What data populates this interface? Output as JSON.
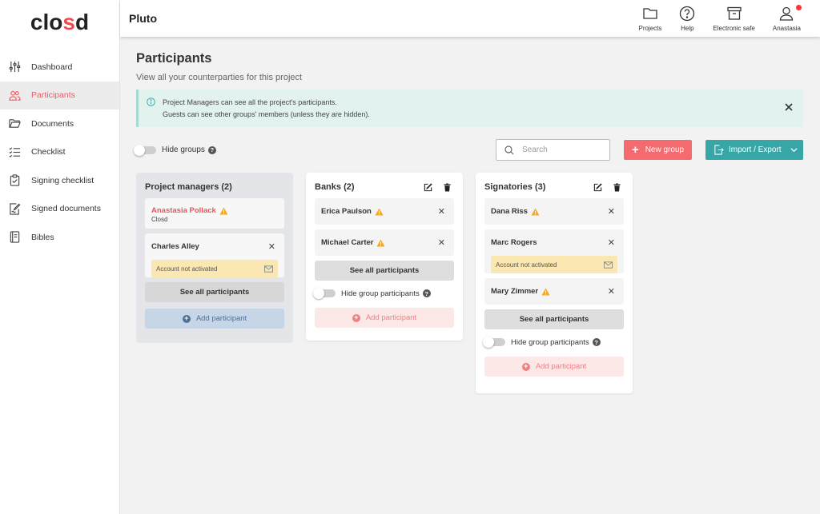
{
  "app": {
    "logo_prefix": "clo",
    "logo_mid": "s",
    "logo_suffix": "d",
    "project_name": "Pluto"
  },
  "sidebar": {
    "items": [
      {
        "label": "Dashboard",
        "icon": "sliders-icon"
      },
      {
        "label": "Participants",
        "icon": "users-icon",
        "active": true
      },
      {
        "label": "Documents",
        "icon": "folder-open-icon"
      },
      {
        "label": "Checklist",
        "icon": "checklist-icon"
      },
      {
        "label": "Signing checklist",
        "icon": "clipboard-icon"
      },
      {
        "label": "Signed documents",
        "icon": "signed-document-icon"
      },
      {
        "label": "Bibles",
        "icon": "book-icon"
      }
    ]
  },
  "topbar": {
    "actions": [
      {
        "label": "Projects",
        "icon": "folder-icon"
      },
      {
        "label": "Help",
        "icon": "help-icon"
      },
      {
        "label": "Electronic safe",
        "icon": "archive-icon"
      },
      {
        "label": "Anastasia",
        "icon": "user-icon"
      }
    ]
  },
  "page": {
    "title": "Participants",
    "subtitle": "View all your counterparties for this project"
  },
  "banner": {
    "line1": "Project Managers can see all the project's participants.",
    "line2": "Guests can see other groups' members (unless they are hidden)."
  },
  "toolbar": {
    "hide_groups_label": "Hide groups",
    "search_placeholder": "Search",
    "new_group_label": "New group",
    "import_export_label": "Import / Export"
  },
  "groups": [
    {
      "title": "Project managers (2)",
      "participants": [
        {
          "name": "Anastasia Pollack",
          "org": "Closd"
        },
        {
          "name": "Charles Alley",
          "status": "Account not activated"
        }
      ],
      "see_all_label": "See all participants",
      "add_label": "Add participant"
    },
    {
      "title": "Banks (2)",
      "participants": [
        {
          "name": "Erica Paulson"
        },
        {
          "name": "Michael Carter"
        }
      ],
      "see_all_label": "See all participants",
      "hide_label": "Hide group participants",
      "add_label": "Add participant"
    },
    {
      "title": "Signatories (3)",
      "participants": [
        {
          "name": "Dana Riss"
        },
        {
          "name": "Marc Rogers",
          "status": "Account not activated"
        },
        {
          "name": "Mary Zimmer"
        }
      ],
      "see_all_label": "See all participants",
      "hide_label": "Hide group participants",
      "add_label": "Add participant"
    }
  ],
  "colors": {
    "accent_red": "#ef5257",
    "teal": "#36a6a6",
    "warning": "#f5a623",
    "banner_bg": "#e2f2ee"
  }
}
